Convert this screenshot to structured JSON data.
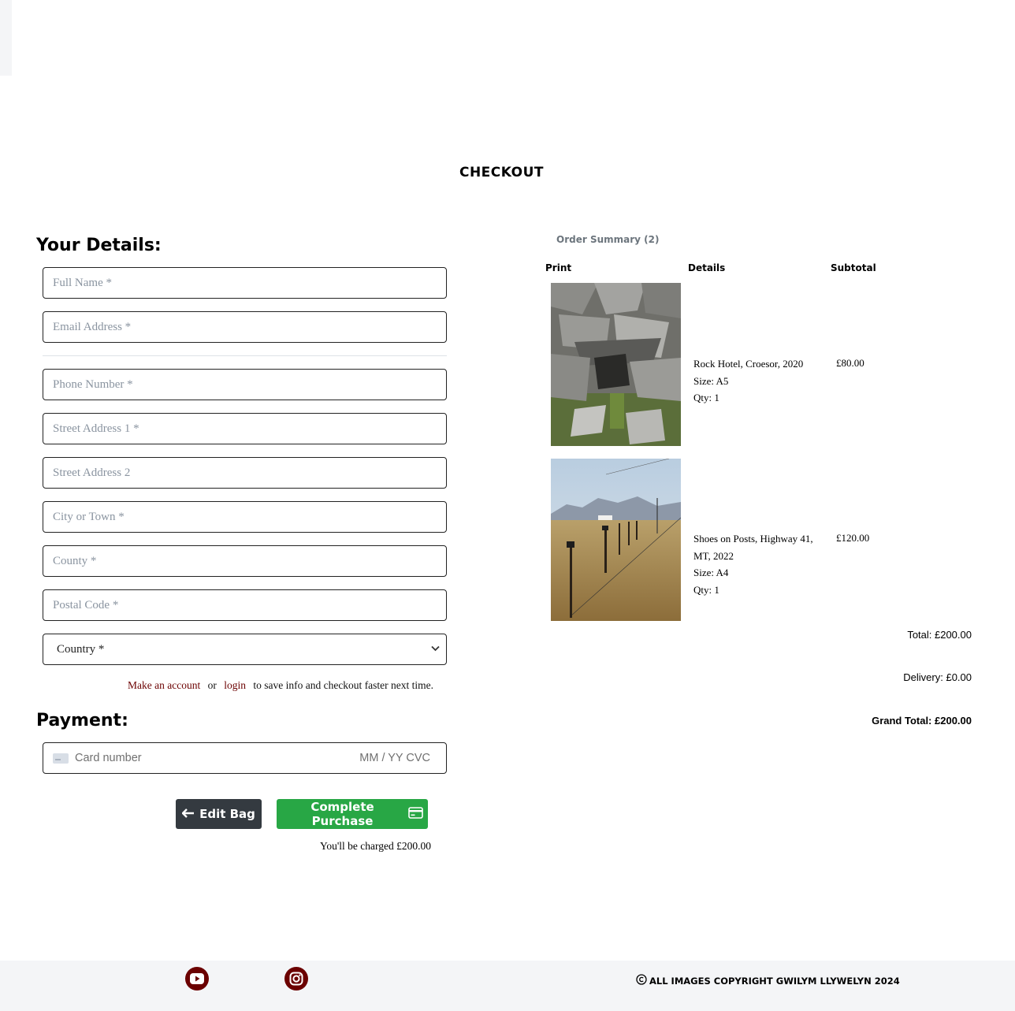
{
  "page": {
    "title": "CHECKOUT"
  },
  "details": {
    "heading": "Your Details:",
    "full_name_placeholder": "Full Name *",
    "email_placeholder": "Email Address *",
    "phone_placeholder": "Phone Number *",
    "street1_placeholder": "Street Address 1 *",
    "street2_placeholder": "Street Address 2",
    "city_placeholder": "City or Town *",
    "county_placeholder": "County *",
    "postal_placeholder": "Postal Code *",
    "country_selected": "Country *",
    "account_prompt": {
      "make_account": "Make an account",
      "or": "or",
      "login": "login",
      "rest": "to save info and checkout faster next time."
    }
  },
  "payment": {
    "heading": "Payment:",
    "card_placeholder": "Card number",
    "expiry_cvc": "MM / YY  CVC",
    "card_icon": "credit-card-icon"
  },
  "actions": {
    "edit_bag": "Edit Bag",
    "complete_purchase": "Complete Purchase",
    "charge_notice": "You'll be charged £200.00"
  },
  "summary": {
    "heading": "Order Summary (2)",
    "columns": [
      "Print",
      "Details",
      "Subtotal"
    ],
    "items": [
      {
        "name": "Rock Hotel, Croesor, 2020",
        "size": "Size: A5",
        "qty": "Qty: 1",
        "subtotal": "£80.00"
      },
      {
        "name": "Shoes on Posts, Highway 41, MT, 2022",
        "size": "Size: A4",
        "qty": "Qty: 1",
        "subtotal": "£120.00"
      }
    ],
    "total": "Total: £200.00",
    "delivery": "Delivery: £0.00",
    "grand_total": "Grand Total: £200.00"
  },
  "footer": {
    "social": [
      "youtube-icon",
      "instagram-icon"
    ],
    "copyright": "ALL IMAGES COPYRIGHT GWILYM LLYWELYN 2024",
    "brand_color": "#6b0000"
  },
  "colors": {
    "accent": "#6b0000",
    "success": "#28a745",
    "dark": "#343a40"
  }
}
